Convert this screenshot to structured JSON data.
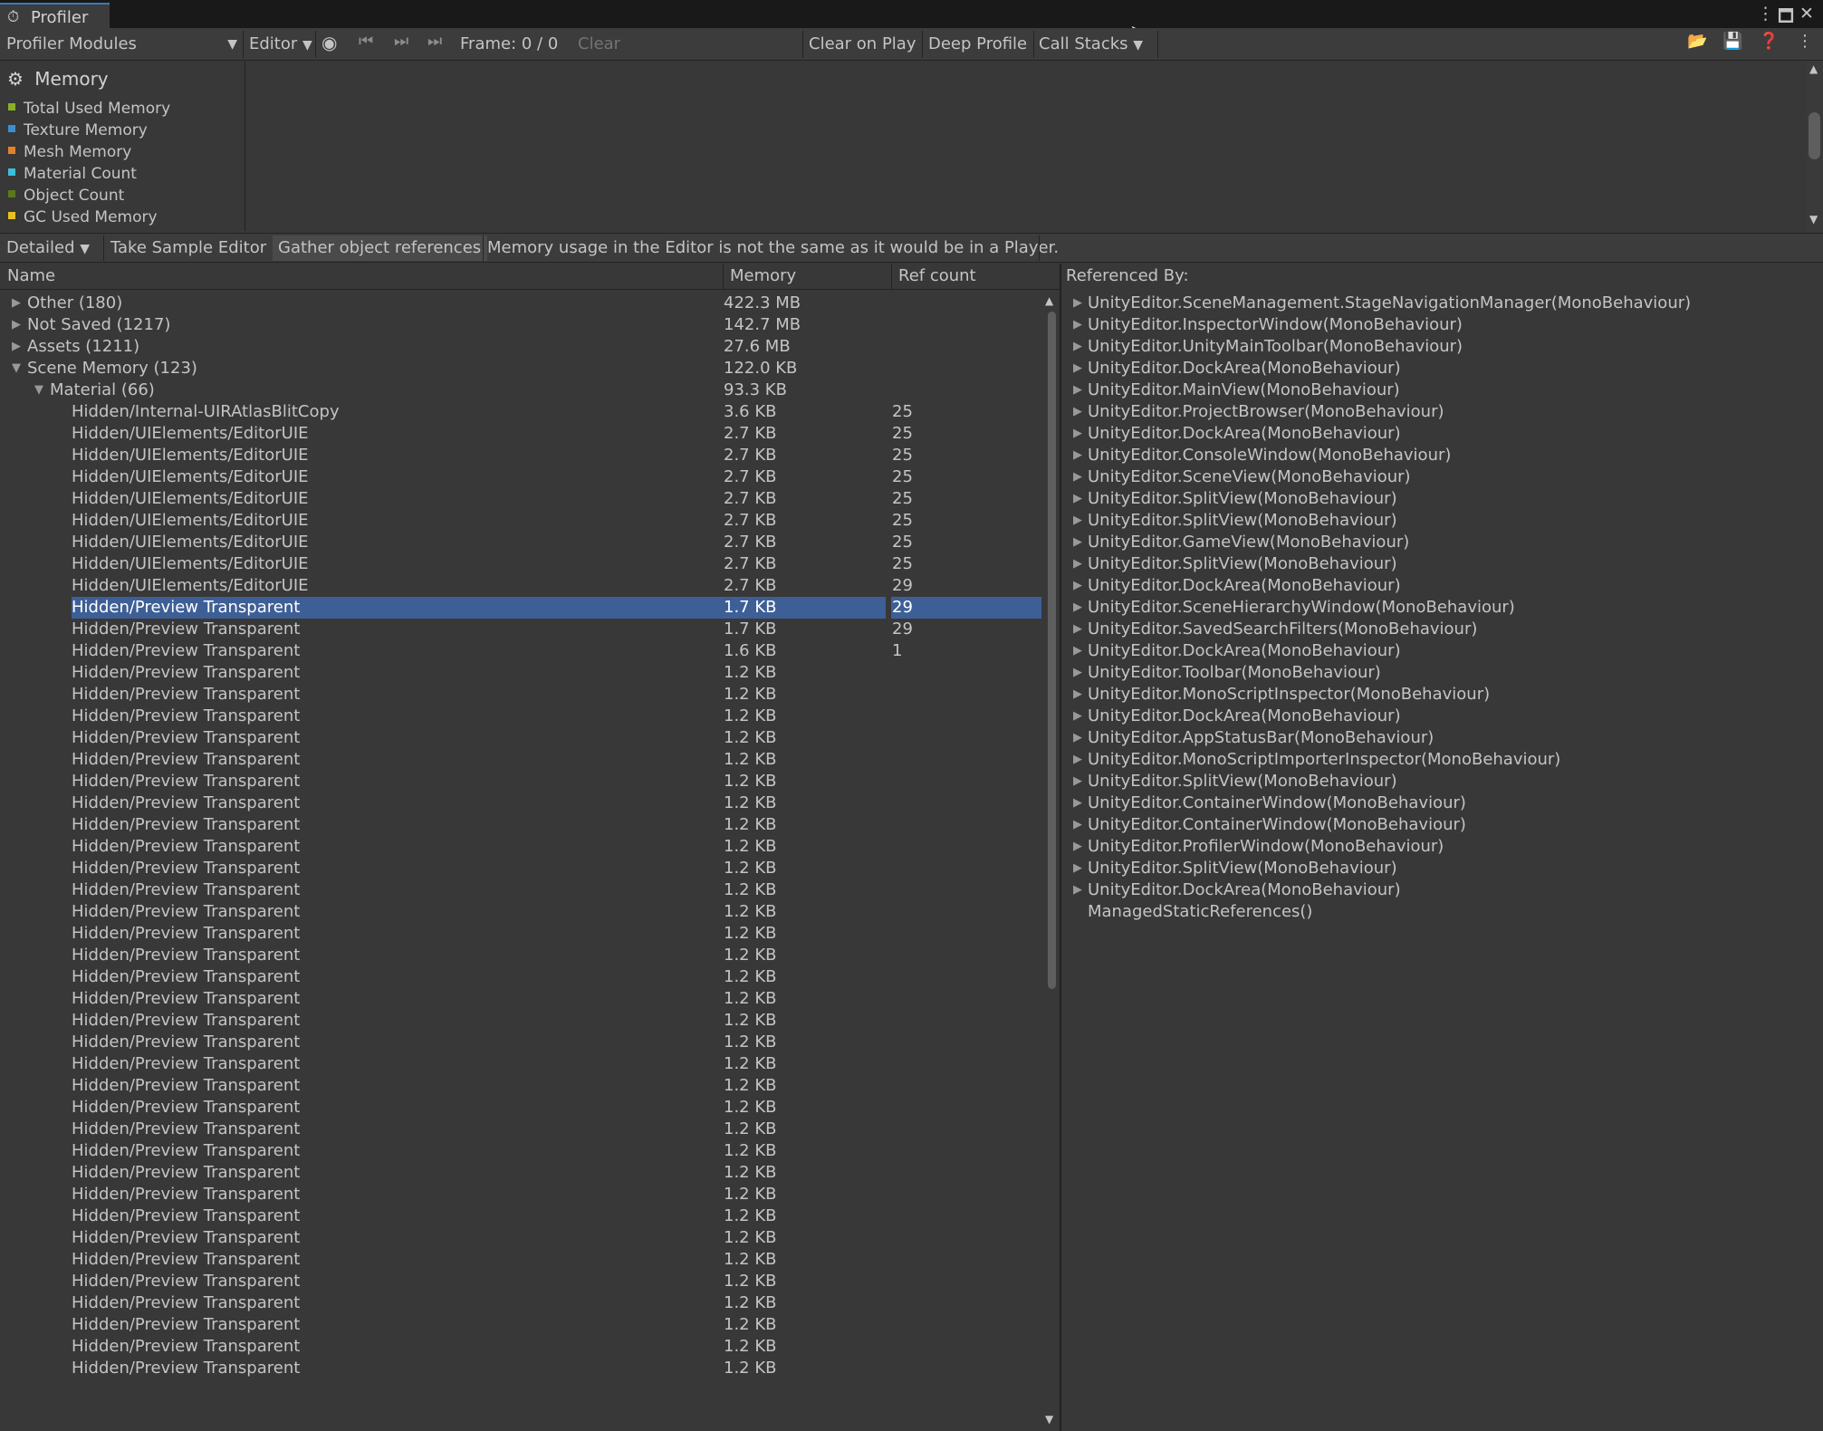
{
  "window": {
    "tab_title": "Profiler",
    "tab_icon": "profiler-icon"
  },
  "toolbar": {
    "modules_label": "Profiler Modules",
    "target_label": "Editor",
    "frame_label": "Frame: 0 / 0",
    "clear_label": "Clear",
    "clear_on_play_label": "Clear on Play",
    "deep_profile_label": "Deep Profile",
    "call_stacks_label": "Call Stacks"
  },
  "module": {
    "title": "Memory",
    "legend": [
      {
        "label": "Total Used Memory",
        "color": "#88b028"
      },
      {
        "label": "Texture Memory",
        "color": "#3b8fd0"
      },
      {
        "label": "Mesh Memory",
        "color": "#e0842c"
      },
      {
        "label": "Material Count",
        "color": "#3ac0d8"
      },
      {
        "label": "Object Count",
        "color": "#5a7a1c"
      },
      {
        "label": "GC Used Memory",
        "color": "#e8c020"
      }
    ]
  },
  "detail_bar": {
    "view_label": "Detailed",
    "take_sample_label": "Take Sample Editor",
    "gather_label": "Gather object references",
    "message": "Memory usage in the Editor is not the same as it would be in a Player."
  },
  "table": {
    "headers": {
      "name": "Name",
      "memory": "Memory",
      "ref_count": "Ref count",
      "referenced_by": "Referenced By:"
    },
    "rows": [
      {
        "name": "Other (180)",
        "mem": "422.3 MB",
        "ref": "",
        "depth": 0,
        "arrow": "right"
      },
      {
        "name": "Not Saved (1217)",
        "mem": "142.7 MB",
        "ref": "",
        "depth": 0,
        "arrow": "right"
      },
      {
        "name": "Assets (1211)",
        "mem": "27.6 MB",
        "ref": "",
        "depth": 0,
        "arrow": "right"
      },
      {
        "name": "Scene Memory (123)",
        "mem": "122.0 KB",
        "ref": "",
        "depth": 0,
        "arrow": "down"
      },
      {
        "name": "Material (66)",
        "mem": "93.3 KB",
        "ref": "",
        "depth": 1,
        "arrow": "down"
      },
      {
        "name": "Hidden/Internal-UIRAtlasBlitCopy",
        "mem": "3.6 KB",
        "ref": "25",
        "depth": 2
      },
      {
        "name": "Hidden/UIElements/EditorUIE",
        "mem": "2.7 KB",
        "ref": "25",
        "depth": 2
      },
      {
        "name": "Hidden/UIElements/EditorUIE",
        "mem": "2.7 KB",
        "ref": "25",
        "depth": 2
      },
      {
        "name": "Hidden/UIElements/EditorUIE",
        "mem": "2.7 KB",
        "ref": "25",
        "depth": 2
      },
      {
        "name": "Hidden/UIElements/EditorUIE",
        "mem": "2.7 KB",
        "ref": "25",
        "depth": 2
      },
      {
        "name": "Hidden/UIElements/EditorUIE",
        "mem": "2.7 KB",
        "ref": "25",
        "depth": 2
      },
      {
        "name": "Hidden/UIElements/EditorUIE",
        "mem": "2.7 KB",
        "ref": "25",
        "depth": 2
      },
      {
        "name": "Hidden/UIElements/EditorUIE",
        "mem": "2.7 KB",
        "ref": "25",
        "depth": 2
      },
      {
        "name": "Hidden/UIElements/EditorUIE",
        "mem": "2.7 KB",
        "ref": "29",
        "depth": 2
      },
      {
        "name": "Hidden/Preview Transparent",
        "mem": "1.7 KB",
        "ref": "29",
        "depth": 2,
        "selected": true
      },
      {
        "name": "Hidden/Preview Transparent",
        "mem": "1.7 KB",
        "ref": "29",
        "depth": 2
      },
      {
        "name": "Hidden/Preview Transparent",
        "mem": "1.6 KB",
        "ref": "1",
        "depth": 2
      },
      {
        "name": "Hidden/Preview Transparent",
        "mem": "1.2 KB",
        "ref": "",
        "depth": 2
      },
      {
        "name": "Hidden/Preview Transparent",
        "mem": "1.2 KB",
        "ref": "",
        "depth": 2
      },
      {
        "name": "Hidden/Preview Transparent",
        "mem": "1.2 KB",
        "ref": "",
        "depth": 2
      },
      {
        "name": "Hidden/Preview Transparent",
        "mem": "1.2 KB",
        "ref": "",
        "depth": 2
      },
      {
        "name": "Hidden/Preview Transparent",
        "mem": "1.2 KB",
        "ref": "",
        "depth": 2
      },
      {
        "name": "Hidden/Preview Transparent",
        "mem": "1.2 KB",
        "ref": "",
        "depth": 2
      },
      {
        "name": "Hidden/Preview Transparent",
        "mem": "1.2 KB",
        "ref": "",
        "depth": 2
      },
      {
        "name": "Hidden/Preview Transparent",
        "mem": "1.2 KB",
        "ref": "",
        "depth": 2
      },
      {
        "name": "Hidden/Preview Transparent",
        "mem": "1.2 KB",
        "ref": "",
        "depth": 2
      },
      {
        "name": "Hidden/Preview Transparent",
        "mem": "1.2 KB",
        "ref": "",
        "depth": 2
      },
      {
        "name": "Hidden/Preview Transparent",
        "mem": "1.2 KB",
        "ref": "",
        "depth": 2
      },
      {
        "name": "Hidden/Preview Transparent",
        "mem": "1.2 KB",
        "ref": "",
        "depth": 2
      },
      {
        "name": "Hidden/Preview Transparent",
        "mem": "1.2 KB",
        "ref": "",
        "depth": 2
      },
      {
        "name": "Hidden/Preview Transparent",
        "mem": "1.2 KB",
        "ref": "",
        "depth": 2
      },
      {
        "name": "Hidden/Preview Transparent",
        "mem": "1.2 KB",
        "ref": "",
        "depth": 2
      },
      {
        "name": "Hidden/Preview Transparent",
        "mem": "1.2 KB",
        "ref": "",
        "depth": 2
      },
      {
        "name": "Hidden/Preview Transparent",
        "mem": "1.2 KB",
        "ref": "",
        "depth": 2
      },
      {
        "name": "Hidden/Preview Transparent",
        "mem": "1.2 KB",
        "ref": "",
        "depth": 2
      },
      {
        "name": "Hidden/Preview Transparent",
        "mem": "1.2 KB",
        "ref": "",
        "depth": 2
      },
      {
        "name": "Hidden/Preview Transparent",
        "mem": "1.2 KB",
        "ref": "",
        "depth": 2
      },
      {
        "name": "Hidden/Preview Transparent",
        "mem": "1.2 KB",
        "ref": "",
        "depth": 2
      },
      {
        "name": "Hidden/Preview Transparent",
        "mem": "1.2 KB",
        "ref": "",
        "depth": 2
      },
      {
        "name": "Hidden/Preview Transparent",
        "mem": "1.2 KB",
        "ref": "",
        "depth": 2
      },
      {
        "name": "Hidden/Preview Transparent",
        "mem": "1.2 KB",
        "ref": "",
        "depth": 2
      },
      {
        "name": "Hidden/Preview Transparent",
        "mem": "1.2 KB",
        "ref": "",
        "depth": 2
      },
      {
        "name": "Hidden/Preview Transparent",
        "mem": "1.2 KB",
        "ref": "",
        "depth": 2
      },
      {
        "name": "Hidden/Preview Transparent",
        "mem": "1.2 KB",
        "ref": "",
        "depth": 2
      },
      {
        "name": "Hidden/Preview Transparent",
        "mem": "1.2 KB",
        "ref": "",
        "depth": 2
      },
      {
        "name": "Hidden/Preview Transparent",
        "mem": "1.2 KB",
        "ref": "",
        "depth": 2
      },
      {
        "name": "Hidden/Preview Transparent",
        "mem": "1.2 KB",
        "ref": "",
        "depth": 2
      },
      {
        "name": "Hidden/Preview Transparent",
        "mem": "1.2 KB",
        "ref": "",
        "depth": 2
      },
      {
        "name": "Hidden/Preview Transparent",
        "mem": "1.2 KB",
        "ref": "",
        "depth": 2
      },
      {
        "name": "Hidden/Preview Transparent",
        "mem": "1.2 KB",
        "ref": "",
        "depth": 2
      }
    ]
  },
  "referenced_by": [
    {
      "text": "UnityEditor.SceneManagement.StageNavigationManager(MonoBehaviour)",
      "arrow": true
    },
    {
      "text": "UnityEditor.InspectorWindow(MonoBehaviour)",
      "arrow": true
    },
    {
      "text": "UnityEditor.UnityMainToolbar(MonoBehaviour)",
      "arrow": true
    },
    {
      "text": "UnityEditor.DockArea(MonoBehaviour)",
      "arrow": true
    },
    {
      "text": "UnityEditor.MainView(MonoBehaviour)",
      "arrow": true
    },
    {
      "text": "UnityEditor.ProjectBrowser(MonoBehaviour)",
      "arrow": true
    },
    {
      "text": "UnityEditor.DockArea(MonoBehaviour)",
      "arrow": true
    },
    {
      "text": "UnityEditor.ConsoleWindow(MonoBehaviour)",
      "arrow": true
    },
    {
      "text": "UnityEditor.SceneView(MonoBehaviour)",
      "arrow": true
    },
    {
      "text": "UnityEditor.SplitView(MonoBehaviour)",
      "arrow": true
    },
    {
      "text": "UnityEditor.SplitView(MonoBehaviour)",
      "arrow": true
    },
    {
      "text": "UnityEditor.GameView(MonoBehaviour)",
      "arrow": true
    },
    {
      "text": "UnityEditor.SplitView(MonoBehaviour)",
      "arrow": true
    },
    {
      "text": "UnityEditor.DockArea(MonoBehaviour)",
      "arrow": true
    },
    {
      "text": "UnityEditor.SceneHierarchyWindow(MonoBehaviour)",
      "arrow": true
    },
    {
      "text": "UnityEditor.SavedSearchFilters(MonoBehaviour)",
      "arrow": true
    },
    {
      "text": "UnityEditor.DockArea(MonoBehaviour)",
      "arrow": true
    },
    {
      "text": "UnityEditor.Toolbar(MonoBehaviour)",
      "arrow": true
    },
    {
      "text": "UnityEditor.MonoScriptInspector(MonoBehaviour)",
      "arrow": true
    },
    {
      "text": "UnityEditor.DockArea(MonoBehaviour)",
      "arrow": true
    },
    {
      "text": "UnityEditor.AppStatusBar(MonoBehaviour)",
      "arrow": true
    },
    {
      "text": "UnityEditor.MonoScriptImporterInspector(MonoBehaviour)",
      "arrow": true
    },
    {
      "text": "UnityEditor.SplitView(MonoBehaviour)",
      "arrow": true
    },
    {
      "text": "UnityEditor.ContainerWindow(MonoBehaviour)",
      "arrow": true
    },
    {
      "text": "UnityEditor.ContainerWindow(MonoBehaviour)",
      "arrow": true
    },
    {
      "text": "UnityEditor.ProfilerWindow(MonoBehaviour)",
      "arrow": true
    },
    {
      "text": "UnityEditor.SplitView(MonoBehaviour)",
      "arrow": true
    },
    {
      "text": "UnityEditor.DockArea(MonoBehaviour)",
      "arrow": true
    },
    {
      "text": "ManagedStaticReferences()",
      "arrow": false
    }
  ]
}
